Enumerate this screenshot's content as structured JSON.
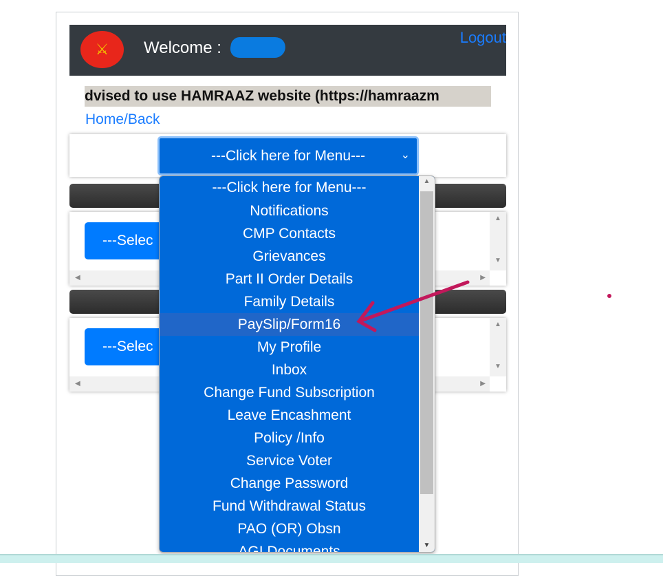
{
  "header": {
    "welcome": "Welcome :",
    "logout": "Logout",
    "logo": "हमराज"
  },
  "marquee": "dvised to use HAMRAAZ website (https://hamraazm",
  "home_back": "Home/Back",
  "menu_select": {
    "selected": "---Click here for Menu---"
  },
  "panels": [
    {
      "select_label": "---Selec"
    },
    {
      "select_label": "---Selec"
    }
  ],
  "dropdown": {
    "highlighted": "PaySlip/Form16",
    "options": [
      "---Click here for Menu---",
      "Notifications",
      "CMP Contacts",
      "Grievances",
      "Part II Order Details",
      "Family Details",
      "PaySlip/Form16",
      "My Profile",
      "Inbox",
      "Change Fund Subscription",
      "Leave Encashment",
      "Policy /Info",
      "Service Voter",
      "Change Password",
      "Fund Withdrawal Status",
      "PAO (OR) Obsn",
      "AGI Documents"
    ]
  },
  "colors": {
    "header_bg": "#343a40",
    "primary": "#007bff",
    "dropdown_bg": "#0069d9",
    "annotation": "#c2185b"
  }
}
